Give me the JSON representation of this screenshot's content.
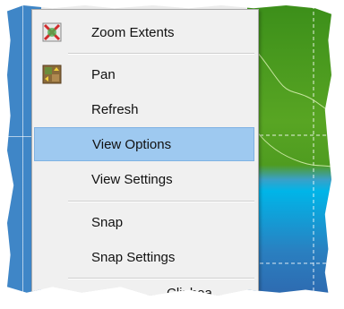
{
  "context_menu": {
    "items": [
      {
        "label": "Zoom Extents",
        "icon": "zoom-extents-icon"
      },
      {
        "label": "Pan",
        "icon": "pan-icon"
      },
      {
        "label": "Refresh",
        "icon": ""
      },
      {
        "label": "View Options",
        "icon": "",
        "highlighted": true
      },
      {
        "label": "View Settings",
        "icon": ""
      },
      {
        "label": "Snap",
        "icon": ""
      },
      {
        "label": "Snap Settings",
        "icon": ""
      }
    ],
    "partial_item_label": "Clipboa"
  },
  "colors": {
    "menu_background": "#f0f0f0",
    "highlight": "#9ec9f0",
    "map_land": "#58a523",
    "map_water": "#00b5e8",
    "left_strip": "#3f86c7"
  }
}
